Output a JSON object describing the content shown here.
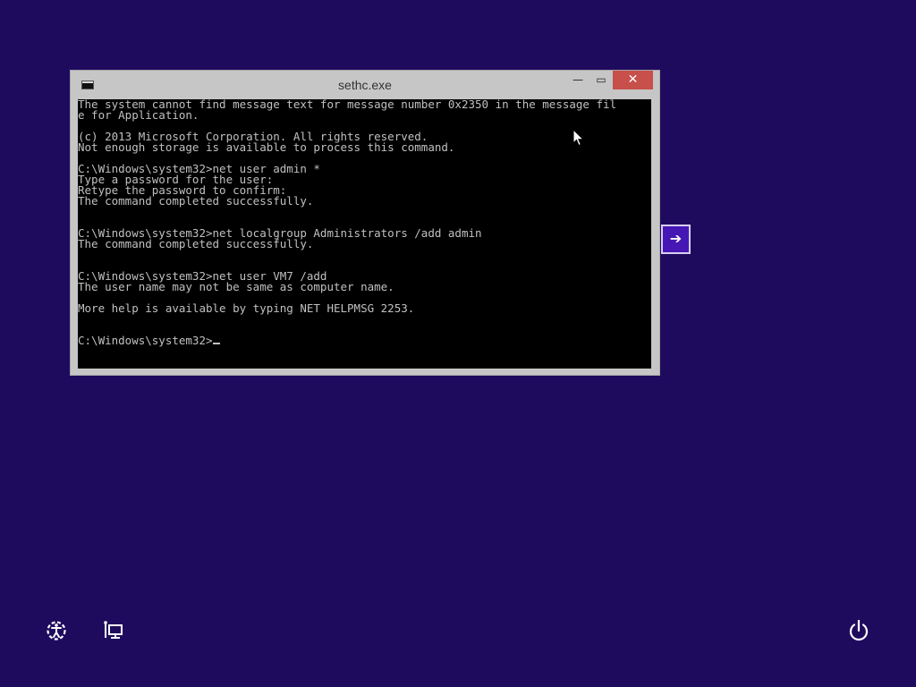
{
  "window": {
    "title": "sethc.exe",
    "icon_label": "C:\\",
    "minimize_glyph": "—",
    "maximize_glyph": "▭",
    "close_glyph": "✕"
  },
  "console": {
    "lines": [
      "The system cannot find message text for message number 0x2350 in the message fil",
      "e for Application.",
      "",
      "(c) 2013 Microsoft Corporation. All rights reserved.",
      "Not enough storage is available to process this command.",
      "",
      "C:\\Windows\\system32>net user admin *",
      "Type a password for the user:",
      "Retype the password to confirm:",
      "The command completed successfully.",
      "",
      "",
      "C:\\Windows\\system32>net localgroup Administrators /add admin",
      "The command completed successfully.",
      "",
      "",
      "C:\\Windows\\system32>net user VM7 /add",
      "The user name may not be same as computer name.",
      "",
      "More help is available by typing NET HELPMSG 2253.",
      "",
      "",
      "C:\\Windows\\system32>"
    ]
  },
  "next_button": {
    "glyph": "➔",
    "icon": "arrow-right-icon"
  },
  "bottom_bar": {
    "ease_of_access_icon": "ease-of-access-icon",
    "network_icon": "network-icon",
    "power_icon": "power-icon"
  },
  "colors": {
    "desktop_background": "#1f0b5e",
    "window_frame": "#c6c6c6",
    "close_button": "#c7504a",
    "console_background": "#000000",
    "console_text": "#c0c0c0",
    "next_button": "#4617b4"
  }
}
